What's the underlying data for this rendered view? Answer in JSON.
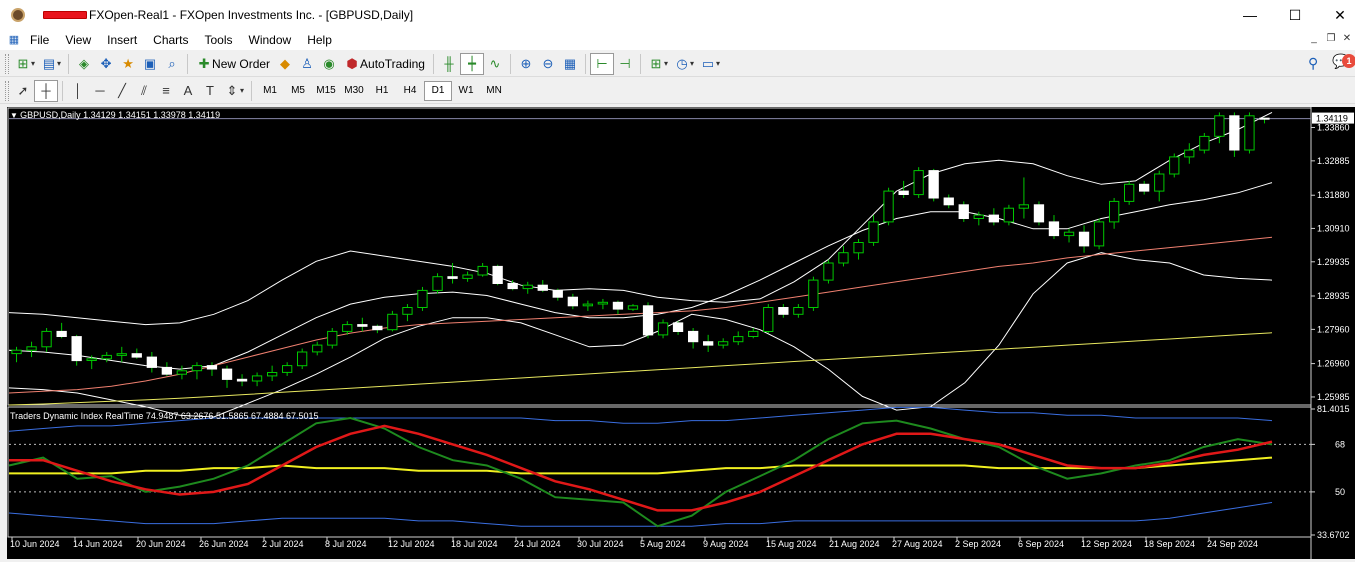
{
  "window": {
    "title": "FXOpen-Real1 - FXOpen Investments Inc. - [GBPUSD,Daily]",
    "minimize": "—",
    "maximize": "☐",
    "close": "✕"
  },
  "menu": [
    "File",
    "View",
    "Insert",
    "Charts",
    "Tools",
    "Window",
    "Help"
  ],
  "toolbar": {
    "new_order": "New Order",
    "autotrading": "AutoTrading"
  },
  "notification_count": "1",
  "timeframes": [
    "M1",
    "M5",
    "M15",
    "M30",
    "H1",
    "H4",
    "D1",
    "W1",
    "MN"
  ],
  "active_timeframe": "D1",
  "main_chart": {
    "header": "GBPUSD,Daily  1.34129 1.34151 1.33978 1.34119",
    "current_price": "1.34119",
    "y_ticks": [
      "1.33860",
      "1.32885",
      "1.31880",
      "1.30910",
      "1.29935",
      "1.28935",
      "1.27960",
      "1.26960",
      "1.25985"
    ],
    "y_range": [
      1.2575,
      1.344
    ],
    "bull_color": "#00c800",
    "bear_color": "#ffffff"
  },
  "indicator": {
    "header": "Traders Dynamic Index RealTime 74.9487 63.2676 51.5865 67.4884 67.5015",
    "y_ticks": [
      "81.4015",
      "68",
      "50",
      "33.6702"
    ],
    "y_range": [
      33.6702,
      81.4015
    ]
  },
  "x_labels": [
    "10 Jun 2024",
    "14 Jun 2024",
    "20 Jun 2024",
    "26 Jun 2024",
    "2 Jul 2024",
    "8 Jul 2024",
    "12 Jul 2024",
    "18 Jul 2024",
    "24 Jul 2024",
    "30 Jul 2024",
    "5 Aug 2024",
    "9 Aug 2024",
    "15 Aug 2024",
    "21 Aug 2024",
    "27 Aug 2024",
    "2 Sep 2024",
    "6 Sep 2024",
    "12 Sep 2024",
    "18 Sep 2024",
    "24 Sep 2024"
  ],
  "chart_data": {
    "type": "candlestick",
    "symbol": "GBPUSD",
    "timeframe": "Daily",
    "ohlc": [
      [
        1.2725,
        1.2745,
        1.27,
        1.2735
      ],
      [
        1.2735,
        1.276,
        1.2715,
        1.2745
      ],
      [
        1.2745,
        1.28,
        1.273,
        1.279
      ],
      [
        1.279,
        1.2815,
        1.277,
        1.2775
      ],
      [
        1.2775,
        1.278,
        1.269,
        1.2705
      ],
      [
        1.2705,
        1.272,
        1.268,
        1.271
      ],
      [
        1.271,
        1.273,
        1.27,
        1.272
      ],
      [
        1.272,
        1.2745,
        1.27,
        1.2725
      ],
      [
        1.2725,
        1.274,
        1.271,
        1.2715
      ],
      [
        1.2715,
        1.273,
        1.267,
        1.2685
      ],
      [
        1.2685,
        1.27,
        1.266,
        1.2665
      ],
      [
        1.2665,
        1.269,
        1.265,
        1.2675
      ],
      [
        1.2675,
        1.27,
        1.265,
        1.269
      ],
      [
        1.269,
        1.27,
        1.266,
        1.268
      ],
      [
        1.268,
        1.269,
        1.2625,
        1.265
      ],
      [
        1.265,
        1.2665,
        1.263,
        1.2645
      ],
      [
        1.2645,
        1.267,
        1.263,
        1.266
      ],
      [
        1.266,
        1.269,
        1.2645,
        1.267
      ],
      [
        1.267,
        1.27,
        1.266,
        1.269
      ],
      [
        1.269,
        1.274,
        1.268,
        1.273
      ],
      [
        1.273,
        1.276,
        1.272,
        1.275
      ],
      [
        1.275,
        1.28,
        1.274,
        1.279
      ],
      [
        1.279,
        1.282,
        1.278,
        1.281
      ],
      [
        1.281,
        1.283,
        1.279,
        1.2805
      ],
      [
        1.2805,
        1.281,
        1.2785,
        1.2795
      ],
      [
        1.2795,
        1.285,
        1.279,
        1.284
      ],
      [
        1.284,
        1.287,
        1.282,
        1.286
      ],
      [
        1.286,
        1.292,
        1.285,
        1.291
      ],
      [
        1.291,
        1.296,
        1.29,
        1.295
      ],
      [
        1.295,
        1.299,
        1.293,
        1.2945
      ],
      [
        1.2945,
        1.2965,
        1.2935,
        1.2955
      ],
      [
        1.2955,
        1.299,
        1.295,
        1.298
      ],
      [
        1.298,
        1.2985,
        1.2925,
        1.293
      ],
      [
        1.293,
        1.294,
        1.291,
        1.2915
      ],
      [
        1.2915,
        1.2935,
        1.29,
        1.2925
      ],
      [
        1.2925,
        1.294,
        1.2905,
        1.291
      ],
      [
        1.291,
        1.2915,
        1.288,
        1.289
      ],
      [
        1.289,
        1.29,
        1.2855,
        1.2865
      ],
      [
        1.2865,
        1.288,
        1.285,
        1.287
      ],
      [
        1.287,
        1.2885,
        1.2855,
        1.2875
      ],
      [
        1.2875,
        1.288,
        1.284,
        1.2855
      ],
      [
        1.2855,
        1.287,
        1.285,
        1.2865
      ],
      [
        1.2865,
        1.2875,
        1.277,
        1.278
      ],
      [
        1.278,
        1.2825,
        1.277,
        1.2815
      ],
      [
        1.2815,
        1.282,
        1.278,
        1.279
      ],
      [
        1.279,
        1.28,
        1.274,
        1.276
      ],
      [
        1.276,
        1.278,
        1.273,
        1.275
      ],
      [
        1.275,
        1.277,
        1.274,
        1.276
      ],
      [
        1.276,
        1.279,
        1.275,
        1.2775
      ],
      [
        1.2775,
        1.28,
        1.277,
        1.279
      ],
      [
        1.279,
        1.287,
        1.2785,
        1.286
      ],
      [
        1.286,
        1.287,
        1.283,
        1.284
      ],
      [
        1.284,
        1.287,
        1.283,
        1.286
      ],
      [
        1.286,
        1.295,
        1.285,
        1.294
      ],
      [
        1.294,
        1.3,
        1.293,
        1.299
      ],
      [
        1.299,
        1.304,
        1.298,
        1.302
      ],
      [
        1.302,
        1.306,
        1.3,
        1.305
      ],
      [
        1.305,
        1.313,
        1.304,
        1.311
      ],
      [
        1.311,
        1.321,
        1.31,
        1.32
      ],
      [
        1.32,
        1.323,
        1.318,
        1.319
      ],
      [
        1.319,
        1.327,
        1.318,
        1.326
      ],
      [
        1.326,
        1.3265,
        1.317,
        1.318
      ],
      [
        1.318,
        1.319,
        1.315,
        1.316
      ],
      [
        1.316,
        1.317,
        1.311,
        1.312
      ],
      [
        1.312,
        1.314,
        1.31,
        1.313
      ],
      [
        1.313,
        1.315,
        1.31,
        1.311
      ],
      [
        1.311,
        1.316,
        1.31,
        1.315
      ],
      [
        1.315,
        1.324,
        1.312,
        1.316
      ],
      [
        1.316,
        1.317,
        1.31,
        1.311
      ],
      [
        1.311,
        1.313,
        1.306,
        1.307
      ],
      [
        1.307,
        1.309,
        1.305,
        1.308
      ],
      [
        1.308,
        1.31,
        1.302,
        1.304
      ],
      [
        1.304,
        1.312,
        1.303,
        1.311
      ],
      [
        1.311,
        1.318,
        1.309,
        1.317
      ],
      [
        1.317,
        1.323,
        1.316,
        1.322
      ],
      [
        1.322,
        1.323,
        1.319,
        1.32
      ],
      [
        1.32,
        1.326,
        1.317,
        1.325
      ],
      [
        1.325,
        1.331,
        1.324,
        1.33
      ],
      [
        1.33,
        1.334,
        1.328,
        1.332
      ],
      [
        1.332,
        1.337,
        1.331,
        1.336
      ],
      [
        1.336,
        1.343,
        1.334,
        1.342
      ],
      [
        1.342,
        1.343,
        1.33,
        1.332
      ],
      [
        1.332,
        1.343,
        1.331,
        1.342
      ],
      [
        1.3413,
        1.3415,
        1.3398,
        1.3412
      ]
    ],
    "bollinger": {
      "upper": [
        1.2845,
        1.284,
        1.283,
        1.282,
        1.281,
        1.2815,
        1.284,
        1.288,
        1.294,
        1.2995,
        1.3025,
        1.301,
        1.2995,
        1.298,
        1.296,
        1.2925,
        1.291,
        1.2915,
        1.291,
        1.289,
        1.288,
        1.2875,
        1.2885,
        1.2935,
        1.3,
        1.31,
        1.32,
        1.325,
        1.328,
        1.329,
        1.328,
        1.3245,
        1.322,
        1.323,
        1.329,
        1.334,
        1.338,
        1.343
      ],
      "middle": [
        1.2735,
        1.273,
        1.272,
        1.2705,
        1.269,
        1.268,
        1.269,
        1.273,
        1.278,
        1.283,
        1.287,
        1.289,
        1.29,
        1.2905,
        1.2895,
        1.287,
        1.2845,
        1.283,
        1.283,
        1.284,
        1.286,
        1.2895,
        1.294,
        1.299,
        1.304,
        1.3085,
        1.312,
        1.314,
        1.314,
        1.312,
        1.309,
        1.309,
        1.312,
        1.314,
        1.316,
        1.3175,
        1.3195,
        1.3225
      ],
      "lower": [
        1.2625,
        1.262,
        1.261,
        1.259,
        1.257,
        1.2545,
        1.254,
        1.258,
        1.262,
        1.2665,
        1.2715,
        1.277,
        1.2805,
        1.283,
        1.283,
        1.2815,
        1.278,
        1.2745,
        1.275,
        1.279,
        1.284,
        1.2825,
        1.2795,
        1.2745,
        1.268,
        1.26,
        1.256,
        1.257,
        1.264,
        1.275,
        1.29,
        1.299,
        1.302,
        1.3,
        1.299,
        1.2955,
        1.2945,
        1.294
      ]
    },
    "ma_slow": [
      1.261,
      1.2615,
      1.262,
      1.263,
      1.2645,
      1.2665,
      1.269,
      1.2715,
      1.274,
      1.2765,
      1.2785,
      1.28,
      1.281,
      1.2815,
      1.282,
      1.2825,
      1.283,
      1.2835,
      1.284,
      1.2845,
      1.285,
      1.286,
      1.2875,
      1.289,
      1.2905,
      1.292,
      1.2935,
      1.295,
      1.2965,
      1.298,
      1.299,
      1.3005,
      1.3015,
      1.3025,
      1.3035,
      1.3045,
      1.3055,
      1.3065
    ],
    "ma_200": [
      1.2575,
      1.2578,
      1.2582,
      1.2586,
      1.259,
      1.2595,
      1.26,
      1.2606,
      1.2612,
      1.2618,
      1.2624,
      1.263,
      1.2636,
      1.2642,
      1.2648,
      1.2654,
      1.266,
      1.2666,
      1.2672,
      1.2678,
      1.2684,
      1.269,
      1.2696,
      1.2702,
      1.2708,
      1.2714,
      1.272,
      1.2726,
      1.2732,
      1.2738,
      1.2744,
      1.275,
      1.2756,
      1.2762,
      1.2768,
      1.2774,
      1.278,
      1.2786
    ],
    "tdi": {
      "upper_band": [
        73,
        74,
        75,
        75,
        76,
        77,
        78,
        78,
        78,
        78,
        78,
        78,
        78,
        78,
        78,
        78,
        77,
        77,
        76,
        76,
        77,
        77,
        78,
        79,
        80,
        81,
        82,
        82,
        81,
        80,
        80,
        79,
        79,
        78,
        78,
        78,
        78,
        77
      ],
      "lower_band": [
        42,
        41,
        40,
        39,
        38,
        38,
        38,
        39,
        40,
        40,
        40,
        40,
        39,
        39,
        38,
        37,
        37,
        37,
        37,
        37,
        37,
        38,
        38,
        39,
        39,
        39,
        39,
        39,
        39,
        39,
        39,
        39,
        39,
        39,
        40,
        42,
        44,
        46
      ],
      "price_line": [
        60,
        63,
        55,
        56,
        50,
        52,
        55,
        60,
        68,
        76,
        78,
        74,
        67,
        62,
        60,
        55,
        48,
        47,
        46,
        37,
        41,
        50,
        56,
        62,
        70,
        76,
        77,
        74,
        70,
        67,
        60,
        55,
        57,
        60,
        62,
        67,
        70,
        68
      ],
      "signal_line": [
        62,
        62,
        58,
        54,
        51,
        49,
        50,
        53,
        60,
        67,
        72,
        75,
        72,
        68,
        64,
        59,
        54,
        51,
        47,
        43,
        43,
        46,
        50,
        56,
        62,
        68,
        72,
        72,
        70,
        68,
        64,
        60,
        59,
        59,
        61,
        64,
        66,
        69
      ],
      "market_base": [
        57,
        57,
        57,
        57,
        58,
        58,
        59,
        59,
        60,
        59,
        59,
        59,
        58,
        58,
        58,
        57,
        57,
        57,
        57,
        57,
        58,
        59,
        59,
        60,
        60,
        60,
        60,
        60,
        60,
        59,
        59,
        59,
        59,
        59,
        60,
        61,
        62,
        63
      ]
    }
  }
}
